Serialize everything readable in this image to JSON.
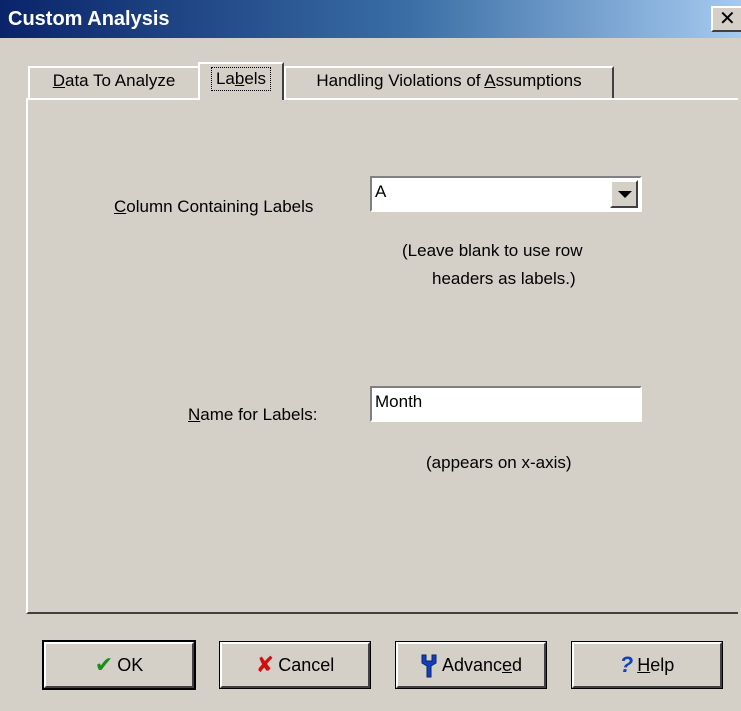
{
  "window": {
    "title": "Custom Analysis",
    "close_glyph": "✕",
    "title_gradient_start": "#0a246a",
    "title_gradient_end": "#a6caf0"
  },
  "tabs": [
    {
      "pre": "",
      "key": "D",
      "post": "ata To Analyze",
      "selected": false
    },
    {
      "pre": "La",
      "key": "b",
      "post": "els",
      "selected": true
    },
    {
      "pre": "Handling Violations of ",
      "key": "A",
      "post": "ssumptions",
      "selected": false
    }
  ],
  "labels_tab": {
    "column_label": {
      "pre": "",
      "key": "C",
      "post": "olumn Containing Labels"
    },
    "column_value": "A",
    "hint_line1": "(Leave blank to use row",
    "hint_line2": "headers as labels.)",
    "name_label": {
      "pre": "",
      "key": "N",
      "post": "ame for Labels:"
    },
    "name_value": "Month",
    "name_hint": "(appears on x-axis)"
  },
  "buttons": {
    "ok": {
      "pre": "OK",
      "key": "",
      "post": "",
      "icon": "check-icon",
      "icon_color": "#1a8f1a"
    },
    "cancel": {
      "pre": "Cancel",
      "key": "",
      "post": "",
      "icon": "x-icon",
      "icon_color": "#d01010"
    },
    "advanced": {
      "pre": "Advanc",
      "key": "e",
      "post": "d",
      "icon": "wrench-icon",
      "icon_color": "#1040c0"
    },
    "help": {
      "pre": "",
      "key": "H",
      "post": "elp",
      "icon": "question-icon",
      "icon_color": "#1040c0"
    }
  },
  "glyphs": {
    "check": "✔",
    "cross": "✘",
    "question": "?"
  }
}
